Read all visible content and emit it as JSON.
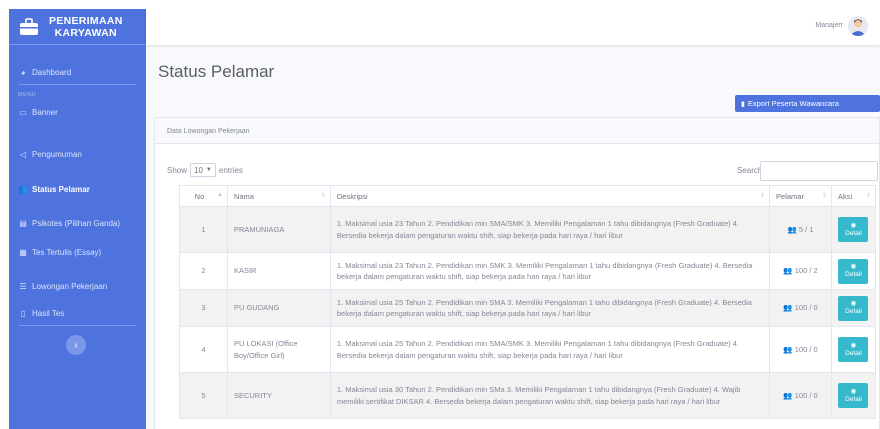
{
  "sidebar": {
    "brand_line1": "PENERIMAAN",
    "brand_line2": "KARYAWAN",
    "dashboard": "Dashboard",
    "menu_heading": "MENU",
    "items": [
      "Banner",
      "Pengumuman",
      "Status Pelamar",
      "Psikotes (Pilihan Ganda)",
      "Tes Tertulis (Essay)",
      "Lowongan Pekerjaan",
      "Hasil Tes"
    ],
    "toggle_icon": "chevron-left-icon"
  },
  "topbar": {
    "user_name": "Manajerr"
  },
  "page": {
    "title": "Status Pelamar",
    "export_label": "Export Peserta Wawancara"
  },
  "card": {
    "header": "Data Lowongan Pekerjaan"
  },
  "controls": {
    "show_label": "Show",
    "entries_value": "10",
    "entries_label": "entries",
    "search_label": "Search:"
  },
  "table": {
    "headers": [
      "No",
      "Nama",
      "Deskripsi",
      "Pelamar",
      "Aksi"
    ],
    "detail_label": "Detail",
    "rows": [
      {
        "no": "1",
        "nama": "PRAMUNIAGA",
        "deskripsi": "1. Maksimal usia 23 Tahun 2. Pendidikan min SMA/SMK 3. Memiliki Pengalaman 1 tahu dibidangnya (Fresh Graduate) 4. Bersedia bekerja dalam pengaturan waktu shift, siap bekerja pada hari raya / hari libur",
        "pelamar": "5 / 1"
      },
      {
        "no": "2",
        "nama": "KASIR",
        "deskripsi": "1. Maksimal usia 23 Tahun 2. Pendidikan min SMK 3. Memiliki Pengalaman 1 tahu dibidangnya (Fresh Graduate) 4. Bersedia bekerja dalam pengaturan waktu shift, siap bekerja pada hari raya / hari libur",
        "pelamar": "100 / 2"
      },
      {
        "no": "3",
        "nama": "PU GUDANG",
        "deskripsi": "1. Maksimal usia 25 Tahun 2. Pendidikan min SMA 3. Memiliki Pengalaman 1 tahu dibidangnya (Fresh Graduate) 4. Bersedia bekerja dalam pengaturan waktu shift, siap bekerja pada hari raya / hari libur",
        "pelamar": "100 / 0"
      },
      {
        "no": "4",
        "nama": "PU LOKASI (Office Boy/Office Girl)",
        "deskripsi": "1. Maksimal usia 25 Tahun 2. Pendidikan min SMA/SMK 3. Memiliki Pengalaman 1 tahu dibidangnya (Fresh Graduate) 4. Bersedia bekerja dalam pengaturan waktu shift, siap bekerja pada hari raya / hari libur",
        "pelamar": "100 / 0"
      },
      {
        "no": "5",
        "nama": "SECURITY",
        "deskripsi": "1. Maksimal usia 30 Tahun 2. Pendidikan min SMa 3. Memiliki Pengalaman 1 tahu dibidangnya (Fresh Graduate) 4. Wajib memiliki sertifikat DIKSAR 4. Bersedia bekerja dalam pengaturan waktu shift, siap bekerja pada hari raya / hari libur",
        "pelamar": "100 / 0"
      }
    ]
  },
  "colors": {
    "primary": "#4e73df",
    "info": "#36b9cc"
  }
}
